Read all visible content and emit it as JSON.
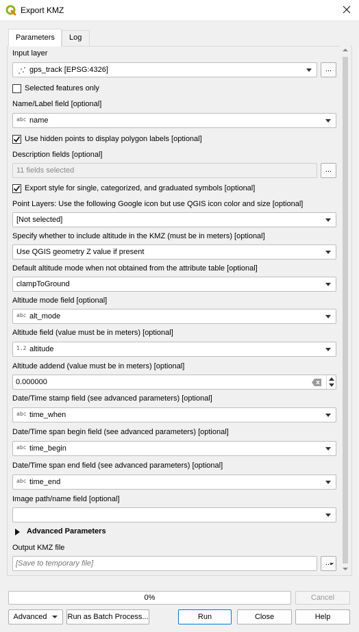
{
  "window": {
    "title": "Export KMZ"
  },
  "tabs": [
    {
      "label": "Parameters"
    },
    {
      "label": "Log"
    }
  ],
  "params": {
    "input_layer": {
      "label": "Input layer",
      "value": "gps_track [EPSG:4326]"
    },
    "selected_only": {
      "label": "Selected features only",
      "checked": false
    },
    "name_field": {
      "label": "Name/Label field [optional]",
      "type": "abc",
      "value": "name"
    },
    "hidden_points": {
      "label": "Use hidden points to display polygon labels [optional]",
      "checked": true
    },
    "description_fields": {
      "label": "Description fields [optional]",
      "value": "11 fields selected"
    },
    "export_style": {
      "label": "Export style for single, categorized, and graduated symbols [optional]",
      "checked": true
    },
    "point_layers": {
      "label": "Point Layers: Use the following Google icon but use QGIS icon color and size [optional]",
      "value": "[Not selected]"
    },
    "altitude_include": {
      "label": "Specify whether to include altitude in the KMZ (must be in meters) [optional]",
      "value": "Use QGIS geometry Z value if present"
    },
    "default_alt_mode": {
      "label": "Default altitude mode when not obtained from the attribute table [optional]",
      "value": "clampToGround"
    },
    "alt_mode_field": {
      "label": "Altitude mode field [optional]",
      "type": "abc",
      "value": "alt_mode"
    },
    "altitude_field": {
      "label": "Altitude field (value must be in meters) [optional]",
      "type": "1.2",
      "value": "altitude"
    },
    "altitude_addend": {
      "label": "Altitude addend (value must be in meters) [optional]",
      "value": "0.000000"
    },
    "time_stamp": {
      "label": "Date/Time stamp field (see advanced parameters) [optional]",
      "type": "abc",
      "value": "time_when"
    },
    "time_begin": {
      "label": "Date/Time span begin field (see advanced parameters) [optional]",
      "type": "abc",
      "value": "time_begin"
    },
    "time_end": {
      "label": "Date/Time span end field (see advanced parameters) [optional]",
      "type": "abc",
      "value": "time_end"
    },
    "image_field": {
      "label": "Image path/name field [optional]",
      "value": ""
    },
    "advanced": {
      "label": "Advanced Parameters"
    },
    "output": {
      "label": "Output KMZ file",
      "placeholder": "[Save to temporary file]"
    }
  },
  "dots_label": "...",
  "progress": {
    "percent": 0,
    "label": "0%"
  },
  "buttons": {
    "cancel": "Cancel",
    "advanced": "Advanced",
    "batch": "Run as Batch Process...",
    "run": "Run",
    "close": "Close",
    "help": "Help"
  },
  "colors": {
    "qgis_green": "#93b023",
    "accent": "#0078d7"
  }
}
